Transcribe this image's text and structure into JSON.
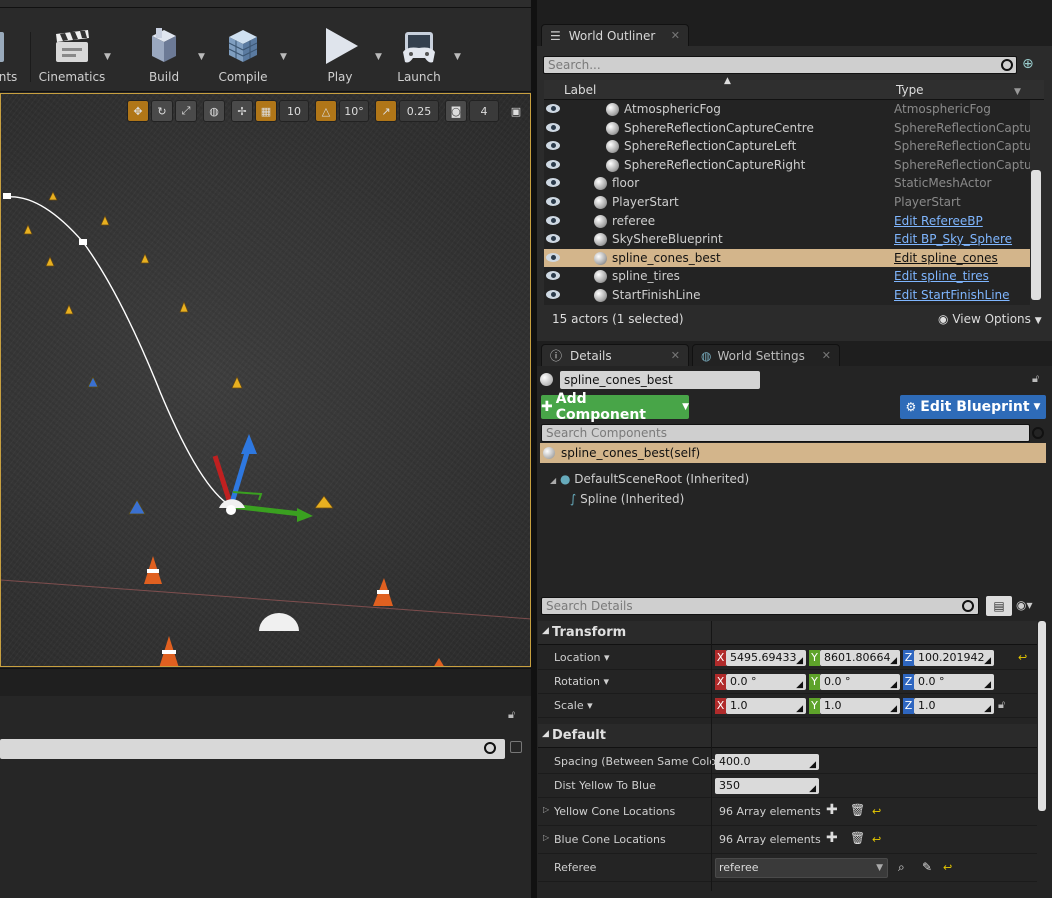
{
  "toolbar": {
    "buttons": [
      {
        "label": "nts",
        "icon": "content-icon"
      },
      {
        "label": "Cinematics",
        "icon": "clapperboard-icon"
      },
      {
        "label": "Build",
        "icon": "build-blocks-icon"
      },
      {
        "label": "Compile",
        "icon": "compile-cube-icon"
      },
      {
        "label": "Play",
        "icon": "play-icon"
      },
      {
        "label": "Launch",
        "icon": "gamepad-icon"
      }
    ]
  },
  "viewport": {
    "grid_snap": "10",
    "rotation_snap": "10°",
    "scale_snap": "0.25",
    "camera_speed": "4"
  },
  "outliner": {
    "tab_title": "World Outliner",
    "search_placeholder": "Search...",
    "col_label": "Label",
    "col_type": "Type",
    "rows": [
      {
        "label": "AtmosphericFog",
        "type": "AtmosphericFog",
        "link": false,
        "indent": 80
      },
      {
        "label": "SphereReflectionCaptureCentre",
        "type": "SphereReflectionCapture",
        "link": false,
        "indent": 80
      },
      {
        "label": "SphereReflectionCaptureLeft",
        "type": "SphereReflectionCapture",
        "link": false,
        "indent": 80
      },
      {
        "label": "SphereReflectionCaptureRight",
        "type": "SphereReflectionCapture",
        "link": false,
        "indent": 80
      },
      {
        "label": "floor",
        "type": "StaticMeshActor",
        "link": false,
        "indent": 68
      },
      {
        "label": "PlayerStart",
        "type": "PlayerStart",
        "link": false,
        "indent": 68
      },
      {
        "label": "referee",
        "type": "Edit RefereeBP",
        "link": true,
        "indent": 68
      },
      {
        "label": "SkyShereBlueprint",
        "type": "Edit BP_Sky_Sphere",
        "link": true,
        "indent": 68
      },
      {
        "label": "spline_cones_best",
        "type": "Edit spline_cones",
        "link": true,
        "indent": 68,
        "selected": true
      },
      {
        "label": "spline_tires",
        "type": "Edit spline_tires",
        "link": true,
        "indent": 68
      },
      {
        "label": "StartFinishLine",
        "type": "Edit StartFinishLine",
        "link": true,
        "indent": 68
      }
    ],
    "status": "15 actors (1 selected)",
    "view_options": "View Options"
  },
  "details": {
    "tab_details": "Details",
    "tab_world_settings": "World Settings",
    "actor_name": "spline_cones_best",
    "add_component": "Add Component",
    "edit_blueprint": "Edit Blueprint",
    "search_components_placeholder": "Search Components",
    "components": {
      "self": "spline_cones_best(self)",
      "root": "DefaultSceneRoot (Inherited)",
      "spline": "Spline (Inherited)"
    },
    "search_details_placeholder": "Search Details",
    "transform": {
      "header": "Transform",
      "location_label": "Location",
      "rotation_label": "Rotation",
      "scale_label": "Scale",
      "location": {
        "x": "5495.69433",
        "y": "8601.80664",
        "z": "100.201942"
      },
      "rotation": {
        "x": "0.0 °",
        "y": "0.0 °",
        "z": "0.0 °"
      },
      "scale": {
        "x": "1.0",
        "y": "1.0",
        "z": "1.0"
      }
    },
    "default": {
      "header": "Default",
      "spacing_label": "Spacing (Between Same Color)",
      "spacing_value": "400.0",
      "dist_label": "Dist Yellow To Blue",
      "dist_value": "350",
      "yellow_label": "Yellow Cone Locations",
      "yellow_value": "96 Array elements",
      "blue_label": "Blue Cone Locations",
      "blue_value": "96 Array elements",
      "referee_label": "Referee",
      "referee_value": "referee"
    },
    "axis": {
      "x": "X",
      "y": "Y",
      "z": "Z"
    }
  }
}
